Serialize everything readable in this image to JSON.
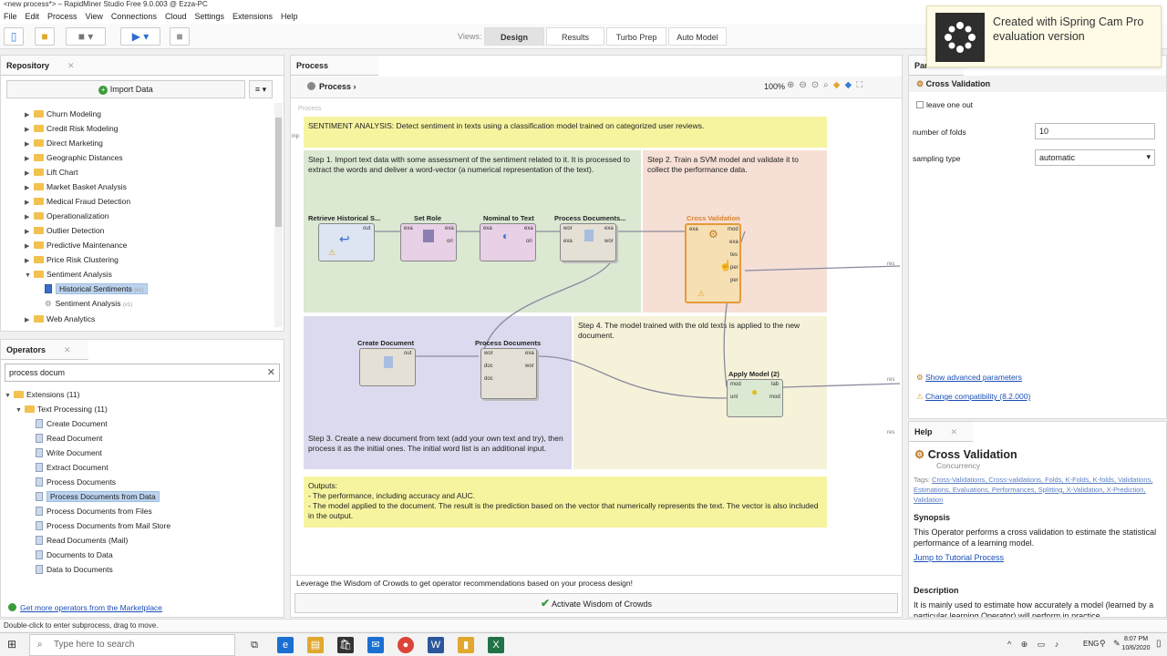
{
  "window": {
    "title": "<new process*> – RapidMiner Studio Free 9.0.003 @ Ezza-PC"
  },
  "menu": [
    "File",
    "Edit",
    "Process",
    "View",
    "Connections",
    "Cloud",
    "Settings",
    "Extensions",
    "Help"
  ],
  "views": {
    "label": "Views:",
    "buttons": [
      "Design",
      "Results",
      "Turbo Prep",
      "Auto Model"
    ],
    "active": "Design"
  },
  "repository": {
    "tab": "Repository",
    "import_label": "Import Data",
    "items": [
      {
        "label": "Churn Modeling",
        "type": "folder"
      },
      {
        "label": "Credit Risk Modeling",
        "type": "folder"
      },
      {
        "label": "Direct Marketing",
        "type": "folder"
      },
      {
        "label": "Geographic Distances",
        "type": "folder"
      },
      {
        "label": "Lift Chart",
        "type": "folder"
      },
      {
        "label": "Market Basket Analysis",
        "type": "folder"
      },
      {
        "label": "Medical Fraud Detection",
        "type": "folder"
      },
      {
        "label": "Operationalization",
        "type": "folder"
      },
      {
        "label": "Outlier Detection",
        "type": "folder"
      },
      {
        "label": "Predictive Maintenance",
        "type": "folder"
      },
      {
        "label": "Price Risk Clustering",
        "type": "folder"
      },
      {
        "label": "Sentiment Analysis",
        "type": "folder-open"
      },
      {
        "label": "Historical Sentiments",
        "type": "data",
        "badge": "(v1)"
      },
      {
        "label": "Sentiment Analysis",
        "type": "process",
        "badge": "(v1)"
      },
      {
        "label": "Web Analytics",
        "type": "folder"
      }
    ]
  },
  "operators": {
    "tab": "Operators",
    "search_value": "process docum",
    "tree": [
      {
        "label": "Extensions (11)",
        "level": 0
      },
      {
        "label": "Text Processing (11)",
        "level": 1
      },
      {
        "label": "Create Document",
        "level": 2
      },
      {
        "label": "Read Document",
        "level": 2
      },
      {
        "label": "Write Document",
        "level": 2
      },
      {
        "label": "Extract Document",
        "level": 2
      },
      {
        "label": "Process Documents",
        "level": 2
      },
      {
        "label": "Process Documents from Data",
        "level": 2,
        "selected": true
      },
      {
        "label": "Process Documents from Files",
        "level": 2
      },
      {
        "label": "Process Documents from Mail Store",
        "level": 2
      },
      {
        "label": "Read Documents (Mail)",
        "level": 2
      },
      {
        "label": "Documents to Data",
        "level": 2
      },
      {
        "label": "Data to Documents",
        "level": 2
      }
    ],
    "marketplace_link": "Get more operators from the Marketplace"
  },
  "process": {
    "tab": "Process",
    "breadcrumb": "Process",
    "zoom": "100%",
    "canvas_label": "Process",
    "title_note": "SENTIMENT ANALYSIS: Detect sentiment in texts using a classification model trained on categorized user reviews.",
    "step1": "Step 1. Import text data with some assessment of the sentiment related to it. It is processed to extract the words and deliver a word-vector (a numerical representation of the text).",
    "step2": "Step 2. Train a SVM model and validate it to collect the performance data.",
    "step3": "Step 3. Create a new document from text (add your own text and try), then process it as the initial ones. The initial word list is an additional input.",
    "step4": "Step 4. The model trained with the old texts is applied to the new document.",
    "outputs": "Outputs:\n- The performance, including accuracy and AUC.\n- The model applied to the document. The result is the prediction based on the vector that numerically represents the text. The vector is also included in the output.",
    "operators": [
      {
        "id": "retrieve",
        "label": "Retrieve Historical S...",
        "ports_out": [
          "out"
        ]
      },
      {
        "id": "setrole",
        "label": "Set Role",
        "ports_in": [
          "exa"
        ],
        "ports_out": [
          "exa",
          "ori"
        ]
      },
      {
        "id": "nominal",
        "label": "Nominal to Text",
        "ports_in": [
          "exa"
        ],
        "ports_out": [
          "exa",
          "ori"
        ]
      },
      {
        "id": "procdocs1",
        "label": "Process Documents...",
        "ports_in": [
          "wor",
          "exa"
        ],
        "ports_out": [
          "exa",
          "wor"
        ]
      },
      {
        "id": "crossval",
        "label": "Cross Validation",
        "ports_in": [
          "exa"
        ],
        "ports_out": [
          "mod",
          "exa",
          "tes",
          "per",
          "per"
        ]
      },
      {
        "id": "createdoc",
        "label": "Create Document",
        "ports_out": [
          "out"
        ]
      },
      {
        "id": "procdocs2",
        "label": "Process Documents",
        "ports_in": [
          "wor",
          "doc",
          "doc"
        ],
        "ports_out": [
          "exa",
          "wor"
        ]
      },
      {
        "id": "applymodel",
        "label": "Apply Model (2)",
        "ports_in": [
          "mod",
          "unl"
        ],
        "ports_out": [
          "lab",
          "mod"
        ]
      }
    ],
    "left_port": "inp",
    "res_ports": [
      "res",
      "res",
      "res"
    ],
    "wisdom_text": "Leverage the Wisdom of Crowds to get operator recommendations based on your process design!",
    "wisdom_button": "Activate Wisdom of Crowds"
  },
  "parameters": {
    "tab": "Par",
    "operator": "Cross Validation",
    "leave_one_out": "leave one out",
    "folds_label": "number of folds",
    "folds_value": "10",
    "sampling_label": "sampling type",
    "sampling_value": "automatic",
    "advanced_link": "Show advanced parameters",
    "compat_link": "Change compatibility (8.2.000)"
  },
  "help": {
    "tab": "Help",
    "title": "Cross Validation",
    "subtitle": "Concurrency",
    "tags_prefix": "Tags:",
    "tags": "Cross-Validations, Cross-validations, Folds, K-Folds, K-folds, Validations, Estimations, Evaluations, Performances, Splitting, X-Validation, X-Prediction, Validation",
    "synopsis_heading": "Synopsis",
    "synopsis": "This Operator performs a cross validation to estimate the statistical performance of a learning model.",
    "tutorial_link": "Jump to Tutorial Process",
    "description_heading": "Description",
    "description": "It is mainly used to estimate how accurately a model (learned by a particular learning Operator) will perform in practice."
  },
  "notification": {
    "line1": "Created with iSpring Cam Pro",
    "line2": "evaluation version"
  },
  "status": "Double-click to enter subprocess, drag to move.",
  "taskbar": {
    "search_placeholder": "Type here to search",
    "lang": "ENG",
    "time": "8:07 PM",
    "date": "10/6/2020"
  },
  "colors": {
    "green_region": "#dbe8d2",
    "salmon_region": "#f6dfd5",
    "lavender_region": "#dcdaee",
    "yellow_note": "#f7f4a0",
    "beige_region": "#f6f2d9",
    "selected_blue": "#bcd3ee",
    "link_blue": "#1a4fb5"
  }
}
